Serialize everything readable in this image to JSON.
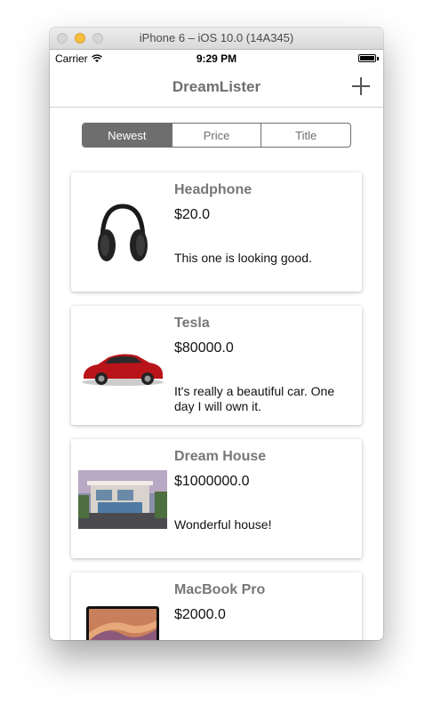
{
  "window": {
    "title": "iPhone 6 – iOS 10.0 (14A345)"
  },
  "status_bar": {
    "carrier": "Carrier",
    "time": "9:29 PM"
  },
  "nav": {
    "title": "DreamLister",
    "add_icon": "plus-icon"
  },
  "sort": {
    "selected": "Newest",
    "options": [
      "Newest",
      "Price",
      "Title"
    ]
  },
  "items": [
    {
      "title": "Headphone",
      "price": "$20.0",
      "details": "This one is looking good.",
      "image": "headphones-image"
    },
    {
      "title": "Tesla",
      "price": "$80000.0",
      "details": "It's really a beautiful car. One day I will own it.",
      "image": "car-image"
    },
    {
      "title": "Dream House",
      "price": "$1000000.0",
      "details": "Wonderful house!",
      "image": "house-image"
    },
    {
      "title": "MacBook Pro",
      "price": "$2000.0",
      "details": "",
      "image": "laptop-image"
    }
  ]
}
